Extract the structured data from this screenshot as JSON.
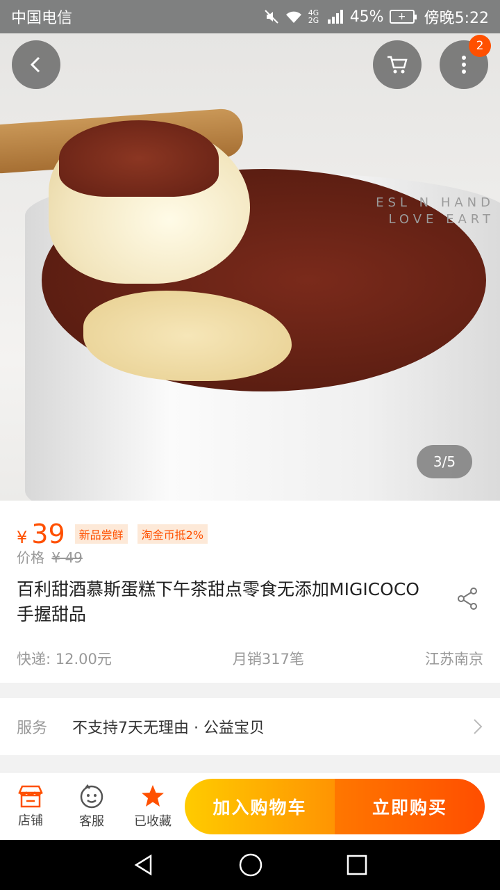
{
  "status_bar": {
    "carrier": "中国电信",
    "network": "4G 2G",
    "battery": "45%",
    "time": "傍晚5:22"
  },
  "hero": {
    "watermark_line1": "ESL N HAND",
    "watermark_line2": "LOVE EART",
    "page_indicator": "3/5",
    "menu_badge": "2"
  },
  "product": {
    "currency": "¥",
    "price": "39",
    "tags": [
      "新品尝鲜",
      "淘金币抵2%"
    ],
    "original_label": "价格",
    "original_price": "¥ 49",
    "title": "百利甜酒慕斯蛋糕下午茶甜点零食无添加MIGICOCO手握甜品",
    "shipping": "快递: 12.00元",
    "monthly_sales": "月销317笔",
    "location": "江苏南京"
  },
  "service": {
    "label": "服务",
    "value": "不支持7天无理由 · 公益宝贝"
  },
  "bottom_bar": {
    "shop": "店铺",
    "customer_service": "客服",
    "favorited": "已收藏",
    "add_to_cart": "加入购物车",
    "buy_now": "立即购买"
  },
  "colors": {
    "accent": "#ff5000",
    "cart_button": "#ffa200",
    "buy_button": "#ff5a00"
  }
}
